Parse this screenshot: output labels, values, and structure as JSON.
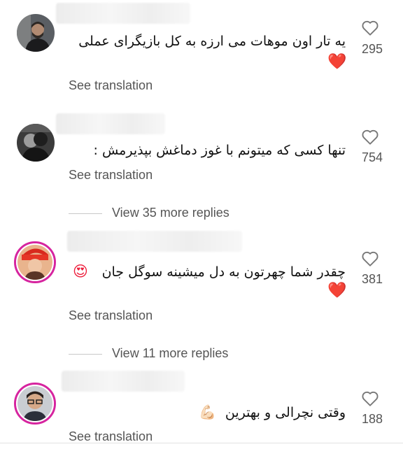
{
  "comments": [
    {
      "text": "یه تار اون موهات می ارزه به کل بازیگرای عملی",
      "emoji": "❤️",
      "see_translation": "See translation",
      "likes": "295",
      "avatar": "man-beard-photo"
    },
    {
      "text": "تنها کسی که میتونم با غوز دماغش بپذیرمش :",
      "emoji": "",
      "see_translation": "See translation",
      "likes": "754",
      "avatar": "monochrome-couple-photo"
    },
    {
      "text": "چقدر شما چهرتون به دل میشینه سوگل جان",
      "emoji_inline": "😍",
      "emoji": "❤️",
      "see_translation": "See translation",
      "likes": "381",
      "avatar": "woman-red-hat-photo"
    },
    {
      "text": "وقتی نچرالی و بهترین",
      "emoji_inline": "💪🏻",
      "see_translation": "See translation",
      "likes": "188",
      "avatar": "man-glasses-photo"
    }
  ],
  "replies": [
    {
      "label": "View 35 more replies"
    },
    {
      "label": "View 11 more replies"
    }
  ],
  "colors": {
    "heart": "#ed1c3a",
    "story_ring": "#d6249f",
    "muted_text": "#555555"
  }
}
